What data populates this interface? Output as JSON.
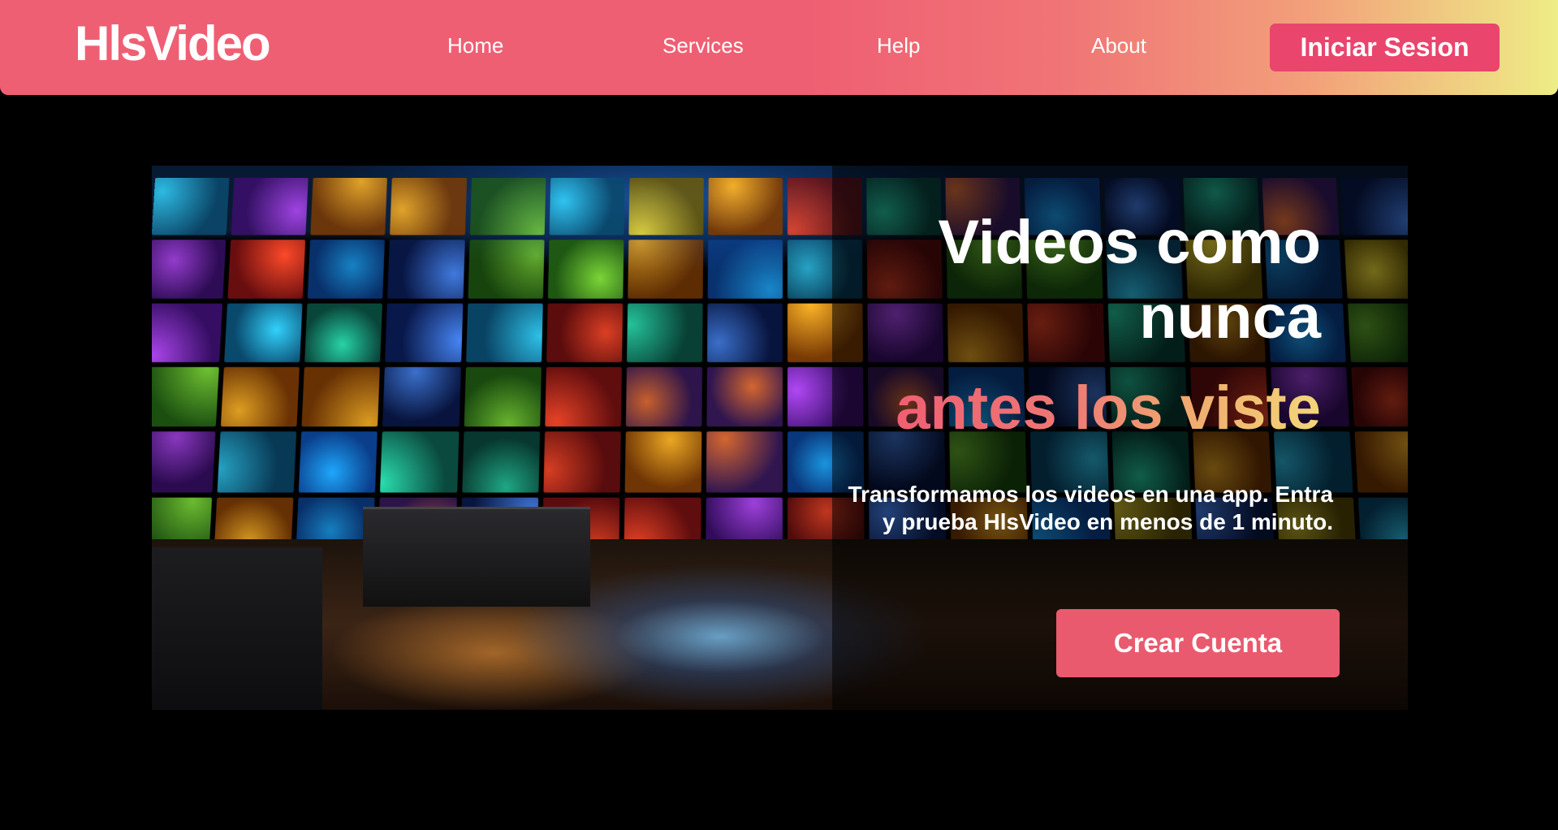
{
  "navbar": {
    "logo": "HlsVideo",
    "links": [
      "Home",
      "Services",
      "Help",
      "About"
    ],
    "login_label": "Iniciar Sesion"
  },
  "hero": {
    "headline_line1": "Videos como",
    "headline_line2": "nunca",
    "headline_line3": "antes los viste",
    "subtitle": "Transformamos los videos en una app. Entra y prueba HlsVideo en menos de 1 minuto.",
    "cta_label": "Crear Cuenta"
  },
  "colors": {
    "brand": "#ef5f73",
    "login_button": "#e9456d",
    "cta_button": "#e95a6e",
    "gradient_end": "#eeed86",
    "background": "#000000"
  }
}
